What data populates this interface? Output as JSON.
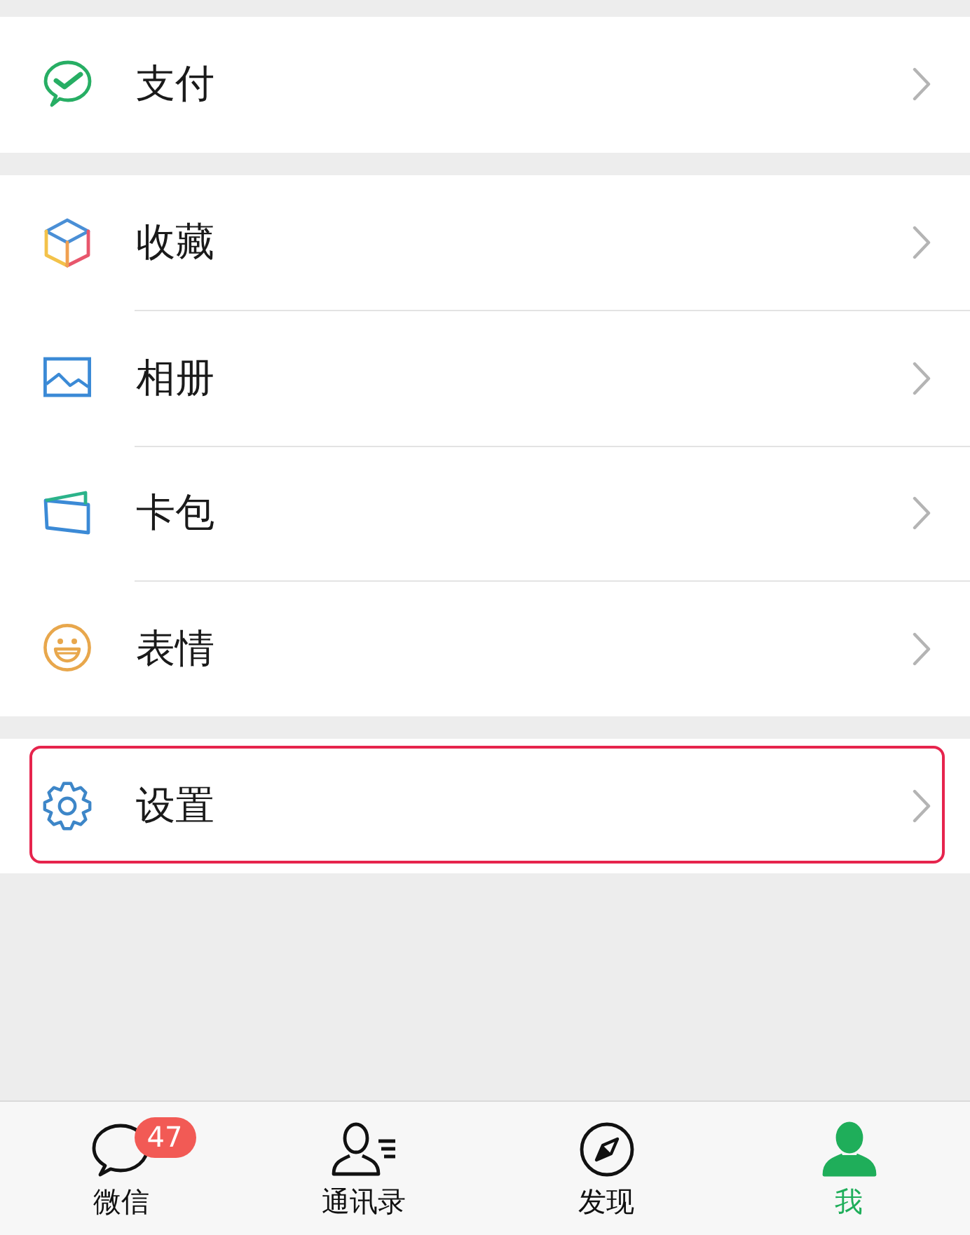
{
  "menu_groups": [
    {
      "items": [
        {
          "kind": "pay",
          "label": "支付",
          "highlighted": false
        }
      ]
    },
    {
      "items": [
        {
          "kind": "favorites",
          "label": "收藏",
          "highlighted": false
        },
        {
          "kind": "album",
          "label": "相册",
          "highlighted": false
        },
        {
          "kind": "cards",
          "label": "卡包",
          "highlighted": false
        },
        {
          "kind": "stickers",
          "label": "表情",
          "highlighted": false
        }
      ]
    },
    {
      "items": [
        {
          "kind": "settings",
          "label": "设置",
          "highlighted": true
        }
      ]
    }
  ],
  "tab_bar": {
    "tabs": [
      {
        "kind": "chats",
        "label": "微信",
        "badge": "47",
        "selected": false
      },
      {
        "kind": "contacts",
        "label": "通讯录",
        "selected": false
      },
      {
        "kind": "discover",
        "label": "发现",
        "selected": false
      },
      {
        "kind": "me",
        "label": "我",
        "selected": true
      }
    ]
  }
}
